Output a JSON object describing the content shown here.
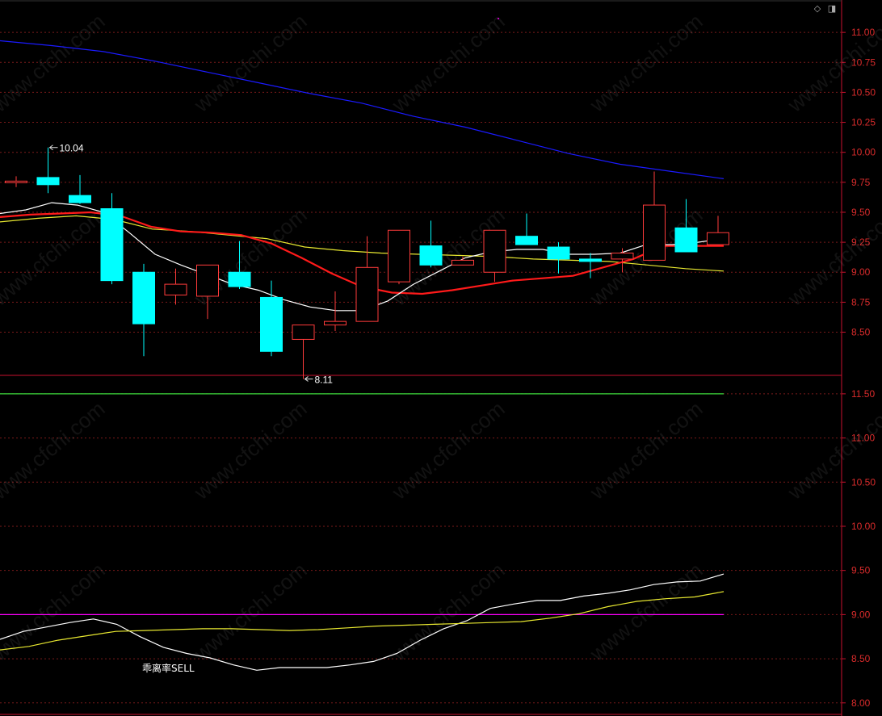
{
  "watermark": "www.cfchi.com",
  "toolbar": {
    "icon_a": "diamond-icon",
    "icon_b": "panel-toggle-icon"
  },
  "colors": {
    "up": "#ff3b3b",
    "down": "#00ffff",
    "axis": "#c8102e",
    "grid": "#7a1a1a",
    "price_label": "#d92b2b",
    "ma_white": "#ffffff",
    "ma_red": "#ff1a1a",
    "ma_yellow": "#e8e830",
    "ma_blue": "#1a1aff",
    "lower_green": "#3cdc3c",
    "lower_magenta": "#ff00ff"
  },
  "chart_data": [
    {
      "type": "candlestick",
      "panel": "main",
      "ylim": [
        8.14,
        11.25
      ],
      "yticks": [
        "11.00",
        "10.75",
        "10.50",
        "10.25",
        "10.00",
        "9.75",
        "9.50",
        "9.25",
        "9.00",
        "8.75",
        "8.50"
      ],
      "candles": [
        {
          "open": 9.76,
          "close": 9.76,
          "high": 9.8,
          "low": 9.71
        },
        {
          "open": 9.79,
          "close": 9.73,
          "high": 10.04,
          "low": 9.66
        },
        {
          "open": 9.64,
          "close": 9.58,
          "high": 9.81,
          "low": 9.57
        },
        {
          "open": 9.53,
          "close": 8.93,
          "high": 9.66,
          "low": 8.9
        },
        {
          "open": 9.0,
          "close": 8.57,
          "high": 9.07,
          "low": 8.3
        },
        {
          "open": 8.81,
          "close": 8.9,
          "high": 9.03,
          "low": 8.73
        },
        {
          "open": 8.8,
          "close": 9.06,
          "high": 9.06,
          "low": 8.61
        },
        {
          "open": 9.0,
          "close": 8.88,
          "high": 9.26,
          "low": 8.86
        },
        {
          "open": 8.79,
          "close": 8.34,
          "high": 8.93,
          "low": 8.3
        },
        {
          "open": 8.44,
          "close": 8.56,
          "high": 8.56,
          "low": 8.11
        },
        {
          "open": 8.56,
          "close": 8.59,
          "high": 8.84,
          "low": 8.51
        },
        {
          "open": 8.59,
          "close": 9.04,
          "high": 9.3,
          "low": 8.59
        },
        {
          "open": 8.92,
          "close": 9.35,
          "high": 9.35,
          "low": 8.9
        },
        {
          "open": 9.22,
          "close": 9.06,
          "high": 9.43,
          "low": 9.04
        },
        {
          "open": 9.06,
          "close": 9.1,
          "high": 9.13,
          "low": 9.06
        },
        {
          "open": 9.0,
          "close": 9.35,
          "high": 9.35,
          "low": 8.92
        },
        {
          "open": 9.3,
          "close": 9.23,
          "high": 9.49,
          "low": 9.23
        },
        {
          "open": 9.21,
          "close": 9.11,
          "high": 9.25,
          "low": 8.99
        },
        {
          "open": 9.11,
          "close": 9.09,
          "high": 9.16,
          "low": 8.95
        },
        {
          "open": 9.11,
          "close": 9.16,
          "high": 9.2,
          "low": 9.0
        },
        {
          "open": 9.1,
          "close": 9.56,
          "high": 9.84,
          "low": 9.1
        },
        {
          "open": 9.37,
          "close": 9.17,
          "high": 9.61,
          "low": 9.17
        },
        {
          "open": 9.23,
          "close": 9.33,
          "high": 9.47,
          "low": 9.23
        }
      ],
      "ma_white": [
        9.49,
        9.52,
        9.58,
        9.56,
        9.5,
        9.33,
        9.15,
        9.06,
        8.98,
        8.9,
        8.85,
        8.77,
        8.71,
        8.68,
        8.68,
        8.76,
        8.9,
        9.01,
        9.12,
        9.17,
        9.19,
        9.19,
        9.15,
        9.15,
        9.16,
        9.23,
        9.23,
        9.25,
        9.28
      ],
      "ma_red": [
        9.46,
        9.48,
        9.49,
        9.5,
        9.47,
        9.38,
        9.34,
        9.33,
        9.31,
        9.24,
        9.12,
        8.99,
        8.88,
        8.83,
        8.82,
        8.85,
        8.89,
        8.93,
        8.95,
        8.97,
        9.04,
        9.11,
        9.22,
        9.22,
        9.22
      ],
      "ma_yellow": [
        9.42,
        9.45,
        9.47,
        9.44,
        9.36,
        9.34,
        9.31,
        9.28,
        9.21,
        9.18,
        9.16,
        9.15,
        9.14,
        9.13,
        9.11,
        9.1,
        9.09,
        9.06,
        9.03,
        9.01
      ],
      "ma_blue": [
        10.93,
        10.89,
        10.84,
        10.76,
        10.67,
        10.58,
        10.49,
        10.41,
        10.3,
        10.21,
        10.1,
        9.99,
        9.9,
        9.84,
        9.78
      ],
      "annotations": [
        {
          "text": "10.04",
          "x_index": 1,
          "value": 10.04,
          "pos": "right"
        },
        {
          "text": "8.11",
          "x_index": 9,
          "value": 8.11,
          "pos": "right"
        }
      ]
    },
    {
      "type": "line",
      "panel": "lower",
      "label": "乖离率SELL",
      "ylim": [
        7.87,
        11.7
      ],
      "yticks": [
        "11.50",
        "11.00",
        "10.50",
        "10.00",
        "9.50",
        "9.00",
        "8.50",
        "8.00"
      ],
      "series": [
        {
          "color": "#3cdc3c",
          "values": [
            11.5,
            11.5
          ]
        },
        {
          "color": "#ff00ff",
          "values": [
            9.0,
            9.0
          ]
        },
        {
          "color": "#ffffff",
          "values": [
            8.72,
            8.81,
            8.86,
            8.91,
            8.95,
            8.89,
            8.75,
            8.63,
            8.56,
            8.51,
            8.43,
            8.37,
            8.4,
            8.4,
            8.4,
            8.43,
            8.47,
            8.56,
            8.71,
            8.84,
            8.93,
            9.07,
            9.12,
            9.16,
            9.16,
            9.21,
            9.24,
            9.28,
            9.34,
            9.37,
            9.38,
            9.46
          ]
        },
        {
          "color": "#e8e830",
          "values": [
            8.6,
            8.64,
            8.71,
            8.76,
            8.81,
            8.82,
            8.83,
            8.84,
            8.84,
            8.83,
            8.82,
            8.83,
            8.85,
            8.87,
            8.88,
            8.89,
            8.9,
            8.91,
            8.92,
            8.96,
            9.01,
            9.09,
            9.15,
            9.18,
            9.2,
            9.26
          ]
        }
      ]
    }
  ]
}
